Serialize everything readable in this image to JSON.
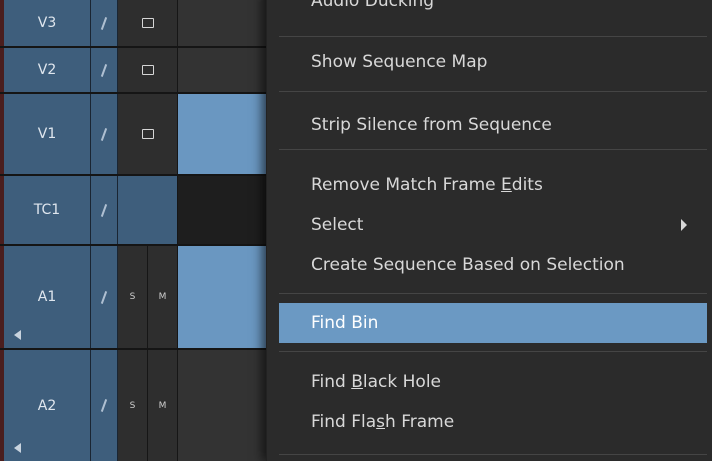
{
  "tracks": [
    {
      "name": "V3",
      "kind": "video"
    },
    {
      "name": "V2",
      "kind": "video"
    },
    {
      "name": "V1",
      "kind": "video"
    },
    {
      "name": "TC1",
      "kind": "timecode"
    },
    {
      "name": "A1",
      "kind": "audio",
      "solo": "S",
      "mute": "M"
    },
    {
      "name": "A2",
      "kind": "audio",
      "solo": "S",
      "mute": "M"
    }
  ],
  "menu": {
    "items": [
      {
        "label": "Audio Ducking",
        "partial": true
      },
      {
        "label": "Show Sequence Map"
      },
      {
        "label": "Strip Silence from Sequence"
      },
      {
        "label_pre": "Remove Match Frame ",
        "label_u": "E",
        "label_post": "dits"
      },
      {
        "label": "Select",
        "submenu": true
      },
      {
        "label": "Create Sequence Based on Selection"
      },
      {
        "label": "Find Bin",
        "highlighted": true
      },
      {
        "label_pre": "Find ",
        "label_u": "B",
        "label_post": "lack Hole"
      },
      {
        "label_pre": "Find Fla",
        "label_u": "s",
        "label_post": "h Frame"
      }
    ]
  },
  "colors": {
    "track_header_blue": "#3e5e7c",
    "clip_blue": "#6a97c1",
    "menu_bg": "#2b2b2b",
    "menu_highlight": "#6b99c3"
  }
}
